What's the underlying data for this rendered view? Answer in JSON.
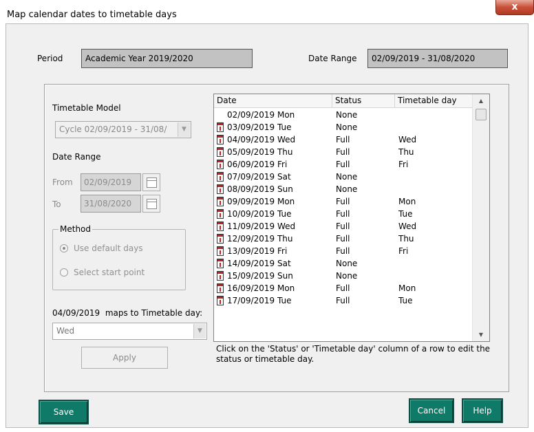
{
  "window": {
    "title": "Map calendar dates to timetable days",
    "close_glyph": "x"
  },
  "period": {
    "label": "Period",
    "value": "Academic Year 2019/2020"
  },
  "date_range_top": {
    "label": "Date Range",
    "value": "02/09/2019 - 31/08/2020"
  },
  "left": {
    "timetable_model_label": "Timetable Model",
    "timetable_model_value": "Cycle 02/09/2019 - 31/08/",
    "date_range_label": "Date Range",
    "from_label": "From",
    "from_value": "02/09/2019",
    "to_label": "To",
    "to_value": "31/08/2020",
    "method_label": "Method",
    "method_options": [
      "Use default days",
      "Select start point"
    ],
    "method_selected": "Use default days",
    "maps_date": "04/09/2019",
    "maps_text": "maps to Timetable day:",
    "maps_value": "Wed",
    "apply_label": "Apply"
  },
  "list": {
    "columns": [
      "Date",
      "Status",
      "Timetable day"
    ],
    "rows": [
      {
        "date": "02/09/2019 Mon",
        "status": "None",
        "day": "",
        "icon": false
      },
      {
        "date": "03/09/2019 Tue",
        "status": "None",
        "day": "",
        "icon": true
      },
      {
        "date": "04/09/2019 Wed",
        "status": "Full",
        "day": "Wed",
        "icon": true
      },
      {
        "date": "05/09/2019 Thu",
        "status": "Full",
        "day": "Thu",
        "icon": true
      },
      {
        "date": "06/09/2019 Fri",
        "status": "Full",
        "day": "Fri",
        "icon": true
      },
      {
        "date": "07/09/2019 Sat",
        "status": "None",
        "day": "",
        "icon": true
      },
      {
        "date": "08/09/2019 Sun",
        "status": "None",
        "day": "",
        "icon": true
      },
      {
        "date": "09/09/2019 Mon",
        "status": "Full",
        "day": "Mon",
        "icon": true
      },
      {
        "date": "10/09/2019 Tue",
        "status": "Full",
        "day": "Tue",
        "icon": true
      },
      {
        "date": "11/09/2019 Wed",
        "status": "Full",
        "day": "Wed",
        "icon": true
      },
      {
        "date": "12/09/2019 Thu",
        "status": "Full",
        "day": "Thu",
        "icon": true
      },
      {
        "date": "13/09/2019 Fri",
        "status": "Full",
        "day": "Fri",
        "icon": true
      },
      {
        "date": "14/09/2019 Sat",
        "status": "None",
        "day": "",
        "icon": true
      },
      {
        "date": "15/09/2019 Sun",
        "status": "None",
        "day": "",
        "icon": true
      },
      {
        "date": "16/09/2019 Mon",
        "status": "Full",
        "day": "Mon",
        "icon": true
      },
      {
        "date": "17/09/2019 Tue",
        "status": "Full",
        "day": "Tue",
        "icon": true
      }
    ],
    "hint": "Click on the 'Status' or 'Timetable day' column of a row to edit the status or timetable day."
  },
  "buttons": {
    "save": "Save",
    "cancel": "Cancel",
    "help": "Help"
  },
  "colors": {
    "accent_button": "#0f7a68",
    "close_button": "#c8503a",
    "readonly_field": "#c2c2c2"
  }
}
